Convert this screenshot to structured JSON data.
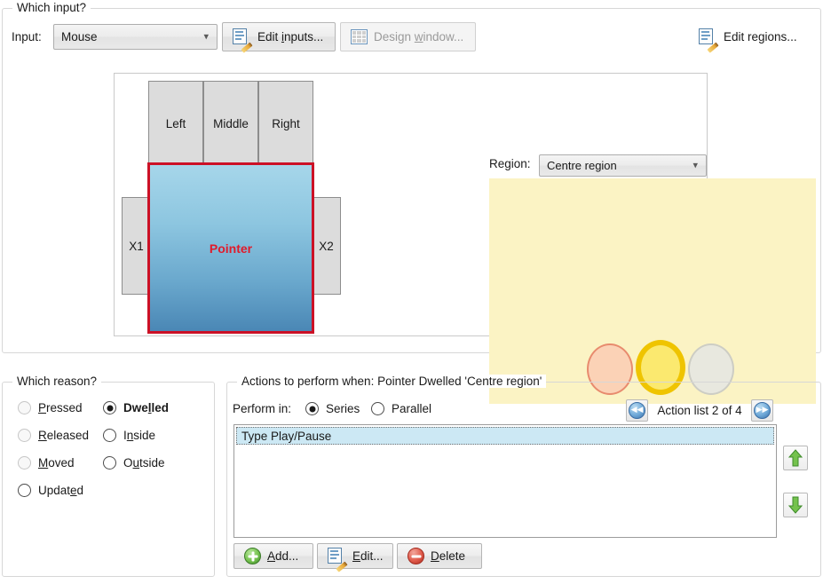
{
  "input_group": {
    "legend": "Which input?",
    "input_label": "Input:",
    "input_value": "Mouse",
    "edit_inputs_label": "Edit inputs...",
    "design_window_label": "Design window...",
    "edit_regions_label": "Edit regions...",
    "icons": {
      "edit_inputs": "edit-document-icon",
      "design_window": "color-grid-icon",
      "edit_regions": "edit-document-icon"
    }
  },
  "diagram": {
    "buttons": {
      "left": "Left",
      "middle": "Middle",
      "right": "Right",
      "x1": "X1",
      "x2": "X2",
      "pointer": "Pointer"
    },
    "colors": {
      "button_fill": "#dcdcdc",
      "button_border": "#8d8d8d",
      "pointer_border": "#cc1126",
      "pointer_label": "#e01b2b",
      "pointer_gradient_top": "#a6d6ea",
      "pointer_gradient_bottom": "#4a87b5"
    }
  },
  "region_panel": {
    "label": "Region:",
    "value": "Centre region",
    "canvas_color": "#fbf3c4",
    "circles": [
      {
        "name": "circle-left",
        "fill": "#fbd2b6",
        "border": "#e88b6e",
        "selected": false
      },
      {
        "name": "circle-centre",
        "fill": "#fbe96f",
        "border": "#efc400",
        "selected": true
      },
      {
        "name": "circle-right",
        "fill": "#e8e8df",
        "border": "#cdcdc4",
        "selected": false
      }
    ]
  },
  "reason_group": {
    "legend": "Which reason?",
    "options": [
      {
        "label": "Pressed",
        "pre": "P",
        "mid": "",
        "post": "ressed",
        "selected": false,
        "dim": true
      },
      {
        "label": "Released",
        "pre": "R",
        "mid": "",
        "post": "eleased",
        "selected": false,
        "dim": true
      },
      {
        "label": "Moved",
        "pre": "M",
        "mid": "",
        "post": "oved",
        "selected": false,
        "dim": true
      },
      {
        "label": "Updated",
        "pre": "a",
        "mid": "Updat",
        "post": "ed",
        "selected": false,
        "dim": false
      },
      {
        "label": "Dwelled",
        "pre": "l",
        "mid": "Dwel",
        "post": "led",
        "selected": true,
        "dim": false
      },
      {
        "label": "Inside",
        "pre": "n",
        "mid": "I",
        "post": "side",
        "selected": false,
        "dim": false
      },
      {
        "label": "Outside",
        "pre": "u",
        "mid": "O",
        "post": "tside",
        "selected": false,
        "dim": false
      }
    ]
  },
  "actions_group": {
    "legend": "Actions to perform when: Pointer Dwelled 'Centre region'",
    "perform_label": "Perform in:",
    "series_label": "Series",
    "parallel_label": "Parallel",
    "series_selected": true,
    "nav": {
      "prev_icon": "chevron-double-left-icon",
      "next_icon": "chevron-double-right-icon",
      "prev_glyph": "◀◀",
      "next_glyph": "▶▶",
      "text": "Action list 2 of 4"
    },
    "list": {
      "items": [
        {
          "label": "Type Play/Pause",
          "selected": true
        }
      ]
    },
    "buttons": {
      "add_label": "Add...",
      "edit_label": "Edit...",
      "delete_label": "Delete",
      "move_up_icon": "arrow-up-icon",
      "move_down_icon": "arrow-down-icon"
    }
  }
}
